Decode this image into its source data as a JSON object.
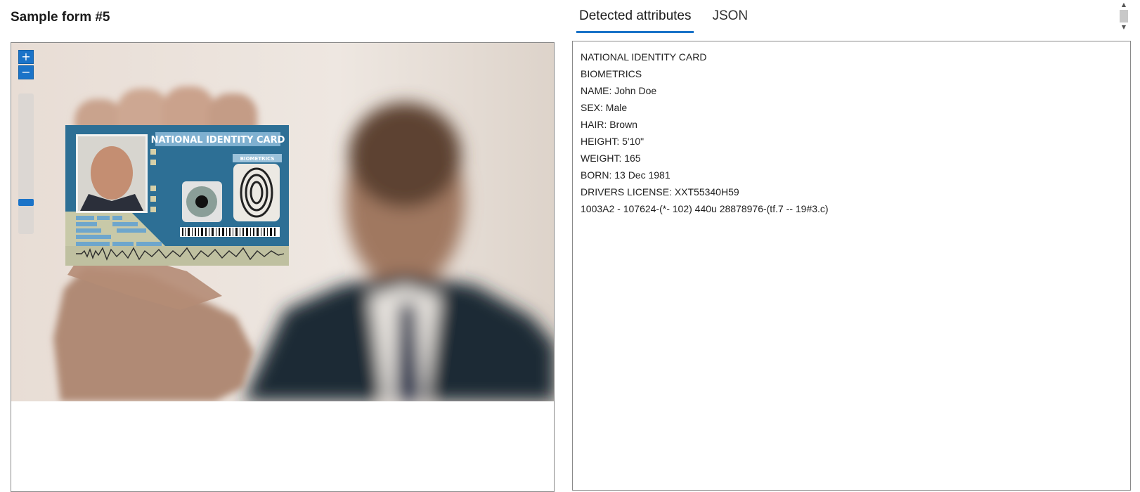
{
  "left": {
    "title": "Sample form #5"
  },
  "viewer": {
    "zoom_in_label": "+",
    "zoom_out_label": "−",
    "zoom_level": 0.12
  },
  "card": {
    "title": "NATIONAL IDENTITY CARD",
    "subtitle": "BIOMETRICS"
  },
  "tabs": [
    {
      "label": "Detected attributes",
      "active": true
    },
    {
      "label": "JSON",
      "active": false
    }
  ],
  "attributes": [
    "NATIONAL IDENTITY CARD",
    "BIOMETRICS",
    "NAME: John Doe",
    "SEX: Male",
    "HAIR: Brown",
    "HEIGHT: 5'10\"",
    "WEIGHT: 165",
    "BORN: 13 Dec 1981",
    "DRIVERS LICENSE: XXT55340H59",
    "1003A2 - 107624-(*- 102) 440u 28878976-(tf.7 -- 19#3.c)"
  ],
  "colors": {
    "accent": "#1a73c8",
    "card_blue": "#2d6f95",
    "suit": "#1e2a36"
  }
}
